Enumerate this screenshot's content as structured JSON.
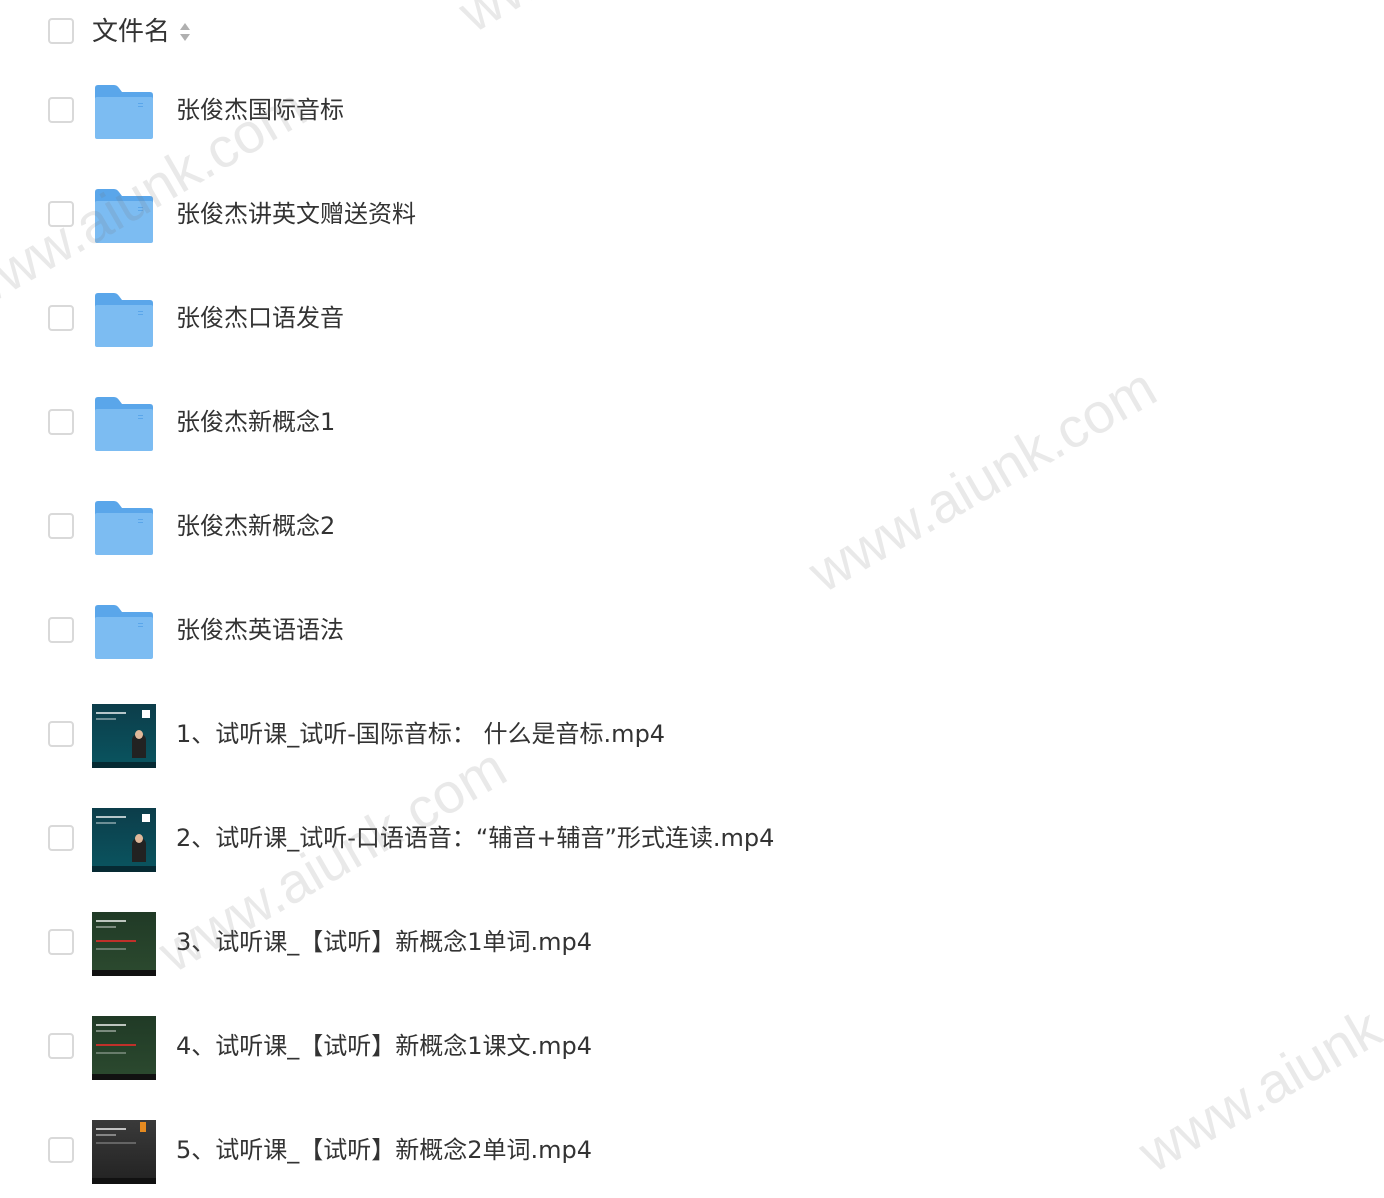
{
  "header": {
    "column_label": "文件名"
  },
  "icons": {
    "sort": "sort-icon",
    "folder": "folder-icon",
    "video": "video-thumbnail"
  },
  "colors": {
    "folder": "#7cbcf2",
    "folder_dark": "#5aa6ea",
    "checkbox_border": "#d9d9d9",
    "text": "#333333"
  },
  "files": [
    {
      "name": "张俊杰国际音标",
      "type": "folder"
    },
    {
      "name": "张俊杰讲英文赠送资料",
      "type": "folder"
    },
    {
      "name": "张俊杰口语发音",
      "type": "folder"
    },
    {
      "name": "张俊杰新概念1",
      "type": "folder"
    },
    {
      "name": "张俊杰新概念2",
      "type": "folder"
    },
    {
      "name": "张俊杰英语语法",
      "type": "folder"
    },
    {
      "name": "1、试听课_试听-国际音标： 什么是音标.mp4",
      "type": "video",
      "thumb": "teal"
    },
    {
      "name": "2、试听课_试听-口语语音：“辅音+辅音”形式连读.mp4",
      "type": "video",
      "thumb": "teal"
    },
    {
      "name": "3、试听课_【试听】新概念1单词.mp4",
      "type": "video",
      "thumb": "green"
    },
    {
      "name": "4、试听课_【试听】新概念1课文.mp4",
      "type": "video",
      "thumb": "green"
    },
    {
      "name": "5、试听课_【试听】新概念2单词.mp4",
      "type": "video",
      "thumb": "dark"
    }
  ],
  "watermarks": [
    "www.aiunk.com",
    "www.aiunk.com",
    "www.aiunk.com",
    "www.aiunk.com",
    "www.aiunk.com"
  ]
}
